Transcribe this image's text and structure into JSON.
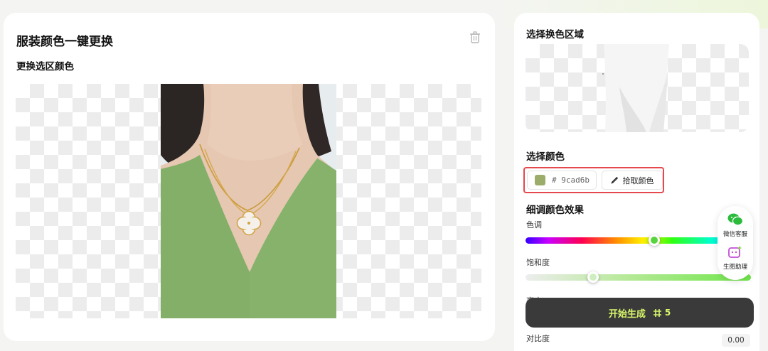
{
  "editor": {
    "title": "服装颜色一键更换",
    "section_label": "更换选区颜色"
  },
  "panel": {
    "region_title": "选择换色区域",
    "color_title": "选择颜色",
    "color_value": "# 9cad6b",
    "color_swatch": "#9cad6b",
    "pick_color_label": "拾取颜色",
    "tune_title": "细调颜色效果",
    "hue_label": "色调",
    "hue_value": 0.57,
    "saturation_label": "饱和度",
    "saturation_value": 0.3,
    "brightness_label": "亮度",
    "contrast_label": "对比度",
    "contrast_value": "0.00",
    "generate_label": "开始生成",
    "generate_cost": "5"
  },
  "float_widget": {
    "service_label": "微信客服",
    "assistant_label": "生图助理"
  },
  "icons": {
    "trash": "trash-icon",
    "eyedropper": "eyedropper-icon",
    "wechat": "wechat-icon",
    "assistant": "assistant-icon",
    "credit": "credit-icon"
  },
  "colors": {
    "accent_text": "#d8f56a",
    "button_bg": "#3a3a3a",
    "highlight": "#e5484d",
    "garment_green": "#86b26c"
  }
}
